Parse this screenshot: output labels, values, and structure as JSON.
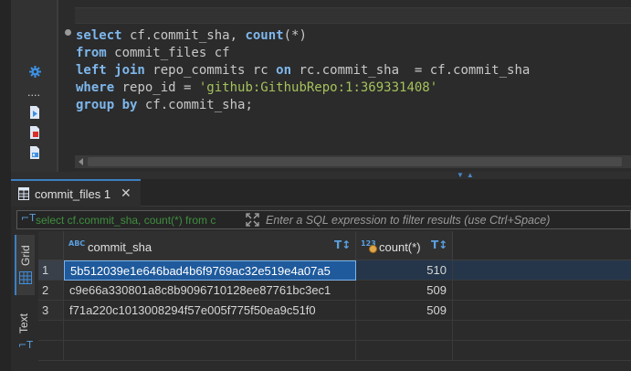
{
  "editor": {
    "lines": [
      [
        {
          "t": "select",
          "c": "kw"
        },
        {
          "t": " cf.commit_sha, ",
          "c": ""
        },
        {
          "t": "count",
          "c": "kw"
        },
        {
          "t": "(*)",
          "c": ""
        }
      ],
      [
        {
          "t": "from",
          "c": "kw"
        },
        {
          "t": " commit_files cf",
          "c": ""
        }
      ],
      [
        {
          "t": "left join",
          "c": "kw"
        },
        {
          "t": " repo_commits rc ",
          "c": ""
        },
        {
          "t": "on",
          "c": "kw"
        },
        {
          "t": " rc.commit_sha  = cf.commit_sha",
          "c": ""
        }
      ],
      [
        {
          "t": "where",
          "c": "kw"
        },
        {
          "t": " repo_id = ",
          "c": ""
        },
        {
          "t": "'github:GithubRepo:1:369331408'",
          "c": "str"
        }
      ],
      [
        {
          "t": "group by",
          "c": "kw"
        },
        {
          "t": " cf.commit_sha;",
          "c": ""
        }
      ]
    ]
  },
  "gutter": {
    "dots": "...."
  },
  "results": {
    "tab_label": "commit_files 1",
    "filter_history": "select cf.commit_sha, count(*) from c",
    "filter_placeholder": "Enter a SQL expression to filter results (use Ctrl+Space)",
    "view_tabs": {
      "grid": "Grid",
      "text": "Text"
    },
    "columns": [
      {
        "label": "commit_sha",
        "type_badge": "ABC"
      },
      {
        "label": "count(*)",
        "type_badge": "123"
      }
    ],
    "rows": [
      {
        "num": "1",
        "sha": "5b512039e1e646bad4b6f9769ac32e519e4a07a5",
        "count": "510"
      },
      {
        "num": "2",
        "sha": "c9e66a330801a8c8b9096710128ee87761bc3ec1",
        "count": "509"
      },
      {
        "num": "3",
        "sha": "f71a220c1013008294f57e005f775f50ea9c51f0",
        "count": "509"
      }
    ],
    "selected_row": 0
  },
  "colors": {
    "accent": "#3d7fc1",
    "keyword": "#7eb7ec",
    "string": "#a5c25c",
    "selection": "#1f5a9c"
  }
}
